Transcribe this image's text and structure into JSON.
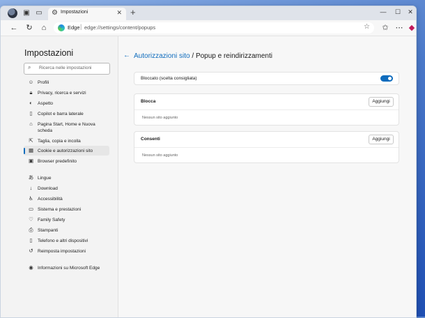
{
  "browser": {
    "tab_title": "Impostazioni",
    "tab_close": "✕",
    "new_tab": "+",
    "site_label": "Edge",
    "url": "edge://settings/content/popups",
    "window_controls": {
      "minimize": "—",
      "maximize": "☐",
      "close": "✕"
    },
    "icons": [
      "profile-avatar-icon",
      "workspaces-icon",
      "tab-actions-icon",
      "settings-gear-icon",
      "back-icon",
      "refresh-icon",
      "home-icon",
      "favorite-star-icon",
      "favorites-icon",
      "extensions-icon",
      "more-icon",
      "copilot-icon"
    ]
  },
  "sidebar": {
    "title": "Impostazioni",
    "search_placeholder": "Ricerca nelle impostazioni",
    "items": [
      {
        "label": "Profili",
        "icon": "profile-icon"
      },
      {
        "label": "Privacy, ricerca e servizi",
        "icon": "lock-icon"
      },
      {
        "label": "Aspetto",
        "icon": "appearance-icon"
      },
      {
        "label": "Copilot e barra laterale",
        "icon": "sidebar-icon"
      },
      {
        "label": "Pagina Start, Home e Nuova scheda",
        "icon": "home-icon"
      },
      {
        "label": "Taglia, copia e incolla",
        "icon": "share-icon"
      },
      {
        "label": "Cookie e autorizzazioni sito",
        "icon": "cookie-icon",
        "active": true
      },
      {
        "label": "Browser predefinito",
        "icon": "browser-icon"
      },
      {
        "label": "Lingue",
        "icon": "language-icon"
      },
      {
        "label": "Download",
        "icon": "download-icon"
      },
      {
        "label": "Accessibilità",
        "icon": "accessibility-icon"
      },
      {
        "label": "Sistema e prestazioni",
        "icon": "system-icon"
      },
      {
        "label": "Family Safety",
        "icon": "family-icon"
      },
      {
        "label": "Stampanti",
        "icon": "printer-icon"
      },
      {
        "label": "Telefono e altri dispositivi",
        "icon": "phone-icon"
      },
      {
        "label": "Reimposta impostazioni",
        "icon": "reset-icon"
      },
      {
        "label": "Informazioni su Microsoft Edge",
        "icon": "edge-icon"
      }
    ]
  },
  "main": {
    "breadcrumb_parent": "Autorizzazioni sito",
    "breadcrumb_sep": " / ",
    "breadcrumb_current": "Popup e reindirizzamenti",
    "blocked_label": "Bloccato (scelta consigliata)",
    "blocked_toggle": true,
    "block_section": {
      "title": "Blocca",
      "add_label": "Aggiungi",
      "empty": "Nessun sito aggiunto"
    },
    "allow_section": {
      "title": "Consenti",
      "add_label": "Aggiungi",
      "empty": "Nessun sito aggiunto"
    }
  },
  "colors": {
    "accent": "#0f6cbd",
    "sidebar_bg": "#f3f3f3",
    "content_bg": "#f7f7f7"
  }
}
